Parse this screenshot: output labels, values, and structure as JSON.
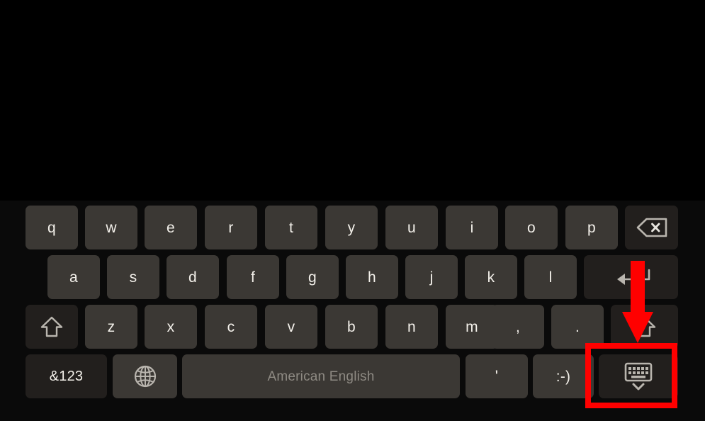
{
  "screen": {
    "background_color": "#000000",
    "description_region": "blank black app area above keyboard"
  },
  "keyboard": {
    "layout_name": "qwerty",
    "language_label": "American English",
    "key_color": "#3b3834",
    "key_color_dark": "#221f1d",
    "key_text_color": "#f2efe9",
    "space_text_color": "#8e8a83",
    "rows": [
      {
        "name": "row-1",
        "keys": [
          {
            "name": "key-q",
            "label": "q",
            "type": "letter"
          },
          {
            "name": "key-w",
            "label": "w",
            "type": "letter"
          },
          {
            "name": "key-e",
            "label": "e",
            "type": "letter"
          },
          {
            "name": "key-r",
            "label": "r",
            "type": "letter"
          },
          {
            "name": "key-t",
            "label": "t",
            "type": "letter"
          },
          {
            "name": "key-y",
            "label": "y",
            "type": "letter"
          },
          {
            "name": "key-u",
            "label": "u",
            "type": "letter"
          },
          {
            "name": "key-i",
            "label": "i",
            "type": "letter"
          },
          {
            "name": "key-o",
            "label": "o",
            "type": "letter"
          },
          {
            "name": "key-p",
            "label": "p",
            "type": "letter"
          },
          {
            "name": "key-backspace",
            "label": "",
            "icon": "backspace-icon",
            "type": "function"
          }
        ]
      },
      {
        "name": "row-2",
        "keys": [
          {
            "name": "key-a",
            "label": "a",
            "type": "letter"
          },
          {
            "name": "key-s",
            "label": "s",
            "type": "letter"
          },
          {
            "name": "key-d",
            "label": "d",
            "type": "letter"
          },
          {
            "name": "key-f",
            "label": "f",
            "type": "letter"
          },
          {
            "name": "key-g",
            "label": "g",
            "type": "letter"
          },
          {
            "name": "key-h",
            "label": "h",
            "type": "letter"
          },
          {
            "name": "key-j",
            "label": "j",
            "type": "letter"
          },
          {
            "name": "key-k",
            "label": "k",
            "type": "letter"
          },
          {
            "name": "key-l",
            "label": "l",
            "type": "letter"
          },
          {
            "name": "key-enter",
            "label": "",
            "icon": "enter-return-icon",
            "type": "function"
          }
        ]
      },
      {
        "name": "row-3",
        "keys": [
          {
            "name": "key-shift-left",
            "label": "",
            "icon": "shift-arrow-up-icon",
            "type": "function"
          },
          {
            "name": "key-z",
            "label": "z",
            "type": "letter"
          },
          {
            "name": "key-x",
            "label": "x",
            "type": "letter"
          },
          {
            "name": "key-c",
            "label": "c",
            "type": "letter"
          },
          {
            "name": "key-v",
            "label": "v",
            "type": "letter"
          },
          {
            "name": "key-b",
            "label": "b",
            "type": "letter"
          },
          {
            "name": "key-n",
            "label": "n",
            "type": "letter"
          },
          {
            "name": "key-m",
            "label": "m",
            "type": "letter"
          },
          {
            "name": "key-comma",
            "label": ",",
            "type": "punctuation"
          },
          {
            "name": "key-period",
            "label": ".",
            "type": "punctuation"
          },
          {
            "name": "key-shift-right",
            "label": "",
            "icon": "shift-arrow-up-icon",
            "type": "function"
          }
        ]
      },
      {
        "name": "row-4",
        "keys": [
          {
            "name": "key-symbols",
            "label": "&123",
            "type": "function"
          },
          {
            "name": "key-language-globe",
            "label": "",
            "icon": "globe-icon",
            "type": "function"
          },
          {
            "name": "key-space",
            "label": "American English",
            "type": "space"
          },
          {
            "name": "key-apostrophe",
            "label": "'",
            "type": "punctuation"
          },
          {
            "name": "key-emoticon",
            "label": ":-)",
            "type": "punctuation"
          },
          {
            "name": "key-hide-keyboard",
            "label": "",
            "icon": "keyboard-hide-icon",
            "type": "function"
          }
        ]
      }
    ]
  },
  "annotation": {
    "color": "#ff0000",
    "highlight_target": "key-hide-keyboard",
    "arrow_direction": "down",
    "box_border_width": "8px"
  }
}
